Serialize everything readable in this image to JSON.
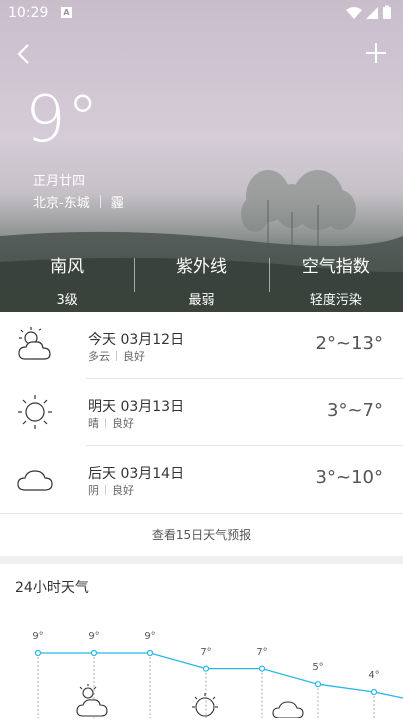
{
  "status_bar": {
    "time": "10:29",
    "notification_icon": "A"
  },
  "header": {
    "back_icon": "chevron-left-icon",
    "add_icon": "plus-icon"
  },
  "current": {
    "temperature": "9°",
    "lunar_date": "正月廿四",
    "location": "北京-东城",
    "extra": "霾"
  },
  "summary": [
    {
      "title": "南风",
      "value": "3级"
    },
    {
      "title": "紫外线",
      "value": "最弱"
    },
    {
      "title": "空气指数",
      "value": "轻度污染"
    }
  ],
  "forecast": [
    {
      "day": "今天 03月12日",
      "weather": "多云",
      "air": "良好",
      "range": "2°~13°",
      "icon": "partly-cloudy-icon"
    },
    {
      "day": "明天 03月13日",
      "weather": "晴",
      "air": "良好",
      "range": "3°~7°",
      "icon": "sun-icon"
    },
    {
      "day": "后天 03月14日",
      "weather": "阴",
      "air": "良好",
      "range": "3°~10°",
      "icon": "cloud-icon"
    }
  ],
  "more_forecast_label": "查看15日天气预报",
  "hourly": {
    "title": "24小时天气",
    "points": [
      {
        "temp": "9°",
        "value": 9
      },
      {
        "temp": "9°",
        "value": 9
      },
      {
        "temp": "9°",
        "value": 9
      },
      {
        "temp": "7°",
        "value": 7
      },
      {
        "temp": "7°",
        "value": 7
      },
      {
        "temp": "5°",
        "value": 5
      },
      {
        "temp": "4°",
        "value": 4
      }
    ],
    "line_color": "#29b6e8"
  }
}
